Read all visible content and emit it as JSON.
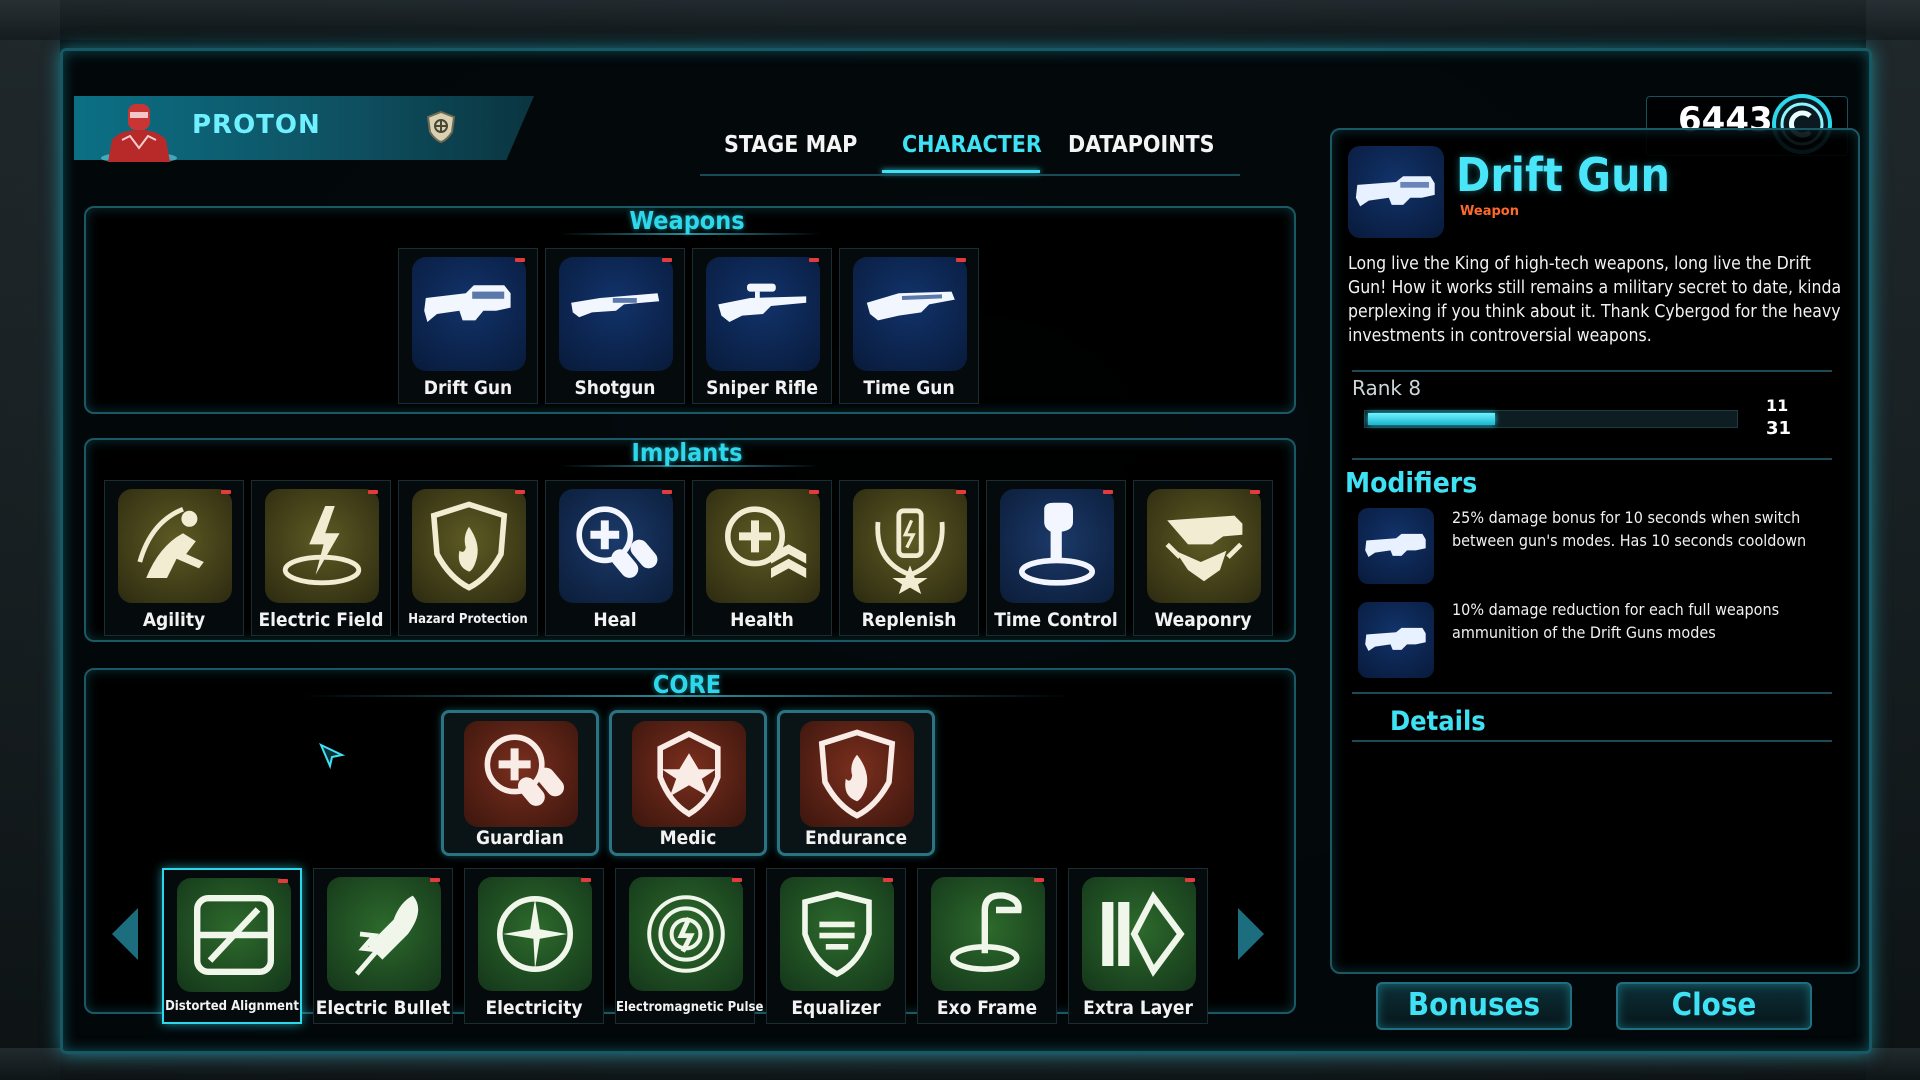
{
  "header": {
    "character_name": "PROTON",
    "tabs": [
      "STAGE MAP",
      "CHARACTER",
      "DATAPOINTS"
    ],
    "active_tab": "CHARACTER",
    "credits": "6443",
    "coin_icon": "credits-coin-icon"
  },
  "sections": {
    "weapons_title": "Weapons",
    "implants_title": "Implants",
    "core_title": "CORE"
  },
  "weapons": [
    {
      "label": "Drift Gun",
      "icon": "drift-gun-icon"
    },
    {
      "label": "Shotgun",
      "icon": "shotgun-icon"
    },
    {
      "label": "Sniper Rifle",
      "icon": "sniper-rifle-icon"
    },
    {
      "label": "Time Gun",
      "icon": "time-gun-icon"
    }
  ],
  "implants": [
    {
      "label": "Agility",
      "icon": "agility-icon"
    },
    {
      "label": "Electric Field",
      "icon": "electric-field-icon"
    },
    {
      "label": "Hazard Protection",
      "icon": "hazard-protection-icon"
    },
    {
      "label": "Heal",
      "icon": "heal-icon"
    },
    {
      "label": "Health",
      "icon": "health-icon"
    },
    {
      "label": "Replenish",
      "icon": "replenish-icon"
    },
    {
      "label": "Time Control",
      "icon": "time-control-icon"
    },
    {
      "label": "Weaponry",
      "icon": "weaponry-icon"
    }
  ],
  "core_classes": [
    {
      "label": "Guardian",
      "icon": "guardian-icon"
    },
    {
      "label": "Medic",
      "icon": "medic-icon"
    },
    {
      "label": "Endurance",
      "icon": "endurance-icon"
    }
  ],
  "core_skills": [
    {
      "label": "Distorted Alignment",
      "icon": "distorted-alignment-icon",
      "selected": true
    },
    {
      "label": "Electric Bullet",
      "icon": "electric-bullet-icon"
    },
    {
      "label": "Electricity",
      "icon": "electricity-icon"
    },
    {
      "label": "Electromagnetic Pulse",
      "icon": "electromagnetic-pulse-icon"
    },
    {
      "label": "Equalizer",
      "icon": "equalizer-icon"
    },
    {
      "label": "Exo Frame",
      "icon": "exo-frame-icon"
    },
    {
      "label": "Extra Layer",
      "icon": "extra-layer-icon"
    }
  ],
  "detail": {
    "title": "Drift Gun",
    "subtitle": "Weapon",
    "description": "Long live the King of high-tech weapons, long live the Drift Gun! How it works still remains a military secret to date, kinda perplexing if you think about it. Thank Cybergod for the heavy investments in controversial weapons.",
    "rank_label": "Rank 8",
    "rank_current": "11",
    "rank_max": "31",
    "rank_progress": 0.35,
    "modifiers_title": "Modifiers",
    "modifiers": [
      "25% damage bonus for 10 seconds when switch between gun's modes. Has 10 seconds cooldown",
      "10% damage reduction for each full weapons ammunition of the Drift Guns modes"
    ],
    "details_title": "Details"
  },
  "buttons": {
    "bonuses": "Bonuses",
    "close": "Close"
  },
  "colors": {
    "accent": "#3ee2f4",
    "weapon_subtitle": "#ff6a2a",
    "indicator": "#e33b3b"
  }
}
